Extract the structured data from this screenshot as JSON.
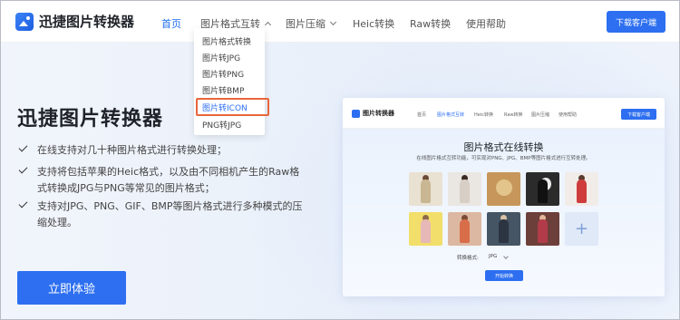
{
  "header": {
    "app_name": "迅捷图片转换器",
    "nav": [
      {
        "label": "首页",
        "active": true
      },
      {
        "label": "图片格式互转",
        "dropdown": "open"
      },
      {
        "label": "图片压缩",
        "dropdown": "closed"
      },
      {
        "label": "Heic转换"
      },
      {
        "label": "Raw转换"
      },
      {
        "label": "使用帮助"
      }
    ],
    "download_button": "下载客户端"
  },
  "dropdown": {
    "items": [
      "图片格式转换",
      "图片转JPG",
      "图片转PNG",
      "图片转BMP",
      "图片转ICON",
      "PNG转JPG"
    ],
    "highlighted": "图片转ICON"
  },
  "hero": {
    "title": "迅捷图片转换器",
    "features": [
      "在线支持对几十种图片格式进行转换处理；",
      "支持将包括苹果的Heic格式，以及由不同相机产生的Raw格式转换成JPG与PNG等常见的图片格式；",
      "支持对JPG、PNG、GIF、BMP等图片格式进行多种模式的压缩处理。"
    ],
    "feature_lines": [
      [
        "在线支持对几十种图片格式进行转换处理；"
      ],
      [
        "支持将包括苹果的Heic格式，以及由不同相机产生的Raw格",
        "式转换成JPG与PNG等常见的图片格式；"
      ],
      [
        "支持对JPG、PNG、GIF、BMP等图片格式进行多种模式的压",
        "缩处理。"
      ]
    ],
    "cta": "立即体验"
  },
  "preview": {
    "app_name": "图片转换器",
    "nav": [
      "首页",
      "图片格式互转",
      "Heic转换",
      "Raw转换",
      "图片压缩",
      "使用帮助"
    ],
    "download_button": "下载客户端",
    "title": "图片格式在线转换",
    "subtitle": "在线图片格式互转功能，可实现对PNG、JPG、BMP等图片格式进行互转处理。",
    "format_label": "转换格式:",
    "format_value": "JPG",
    "convert_button": "开始转换",
    "add_icon": "plus-icon",
    "colors": {
      "accent": "#2d6ff0"
    }
  }
}
